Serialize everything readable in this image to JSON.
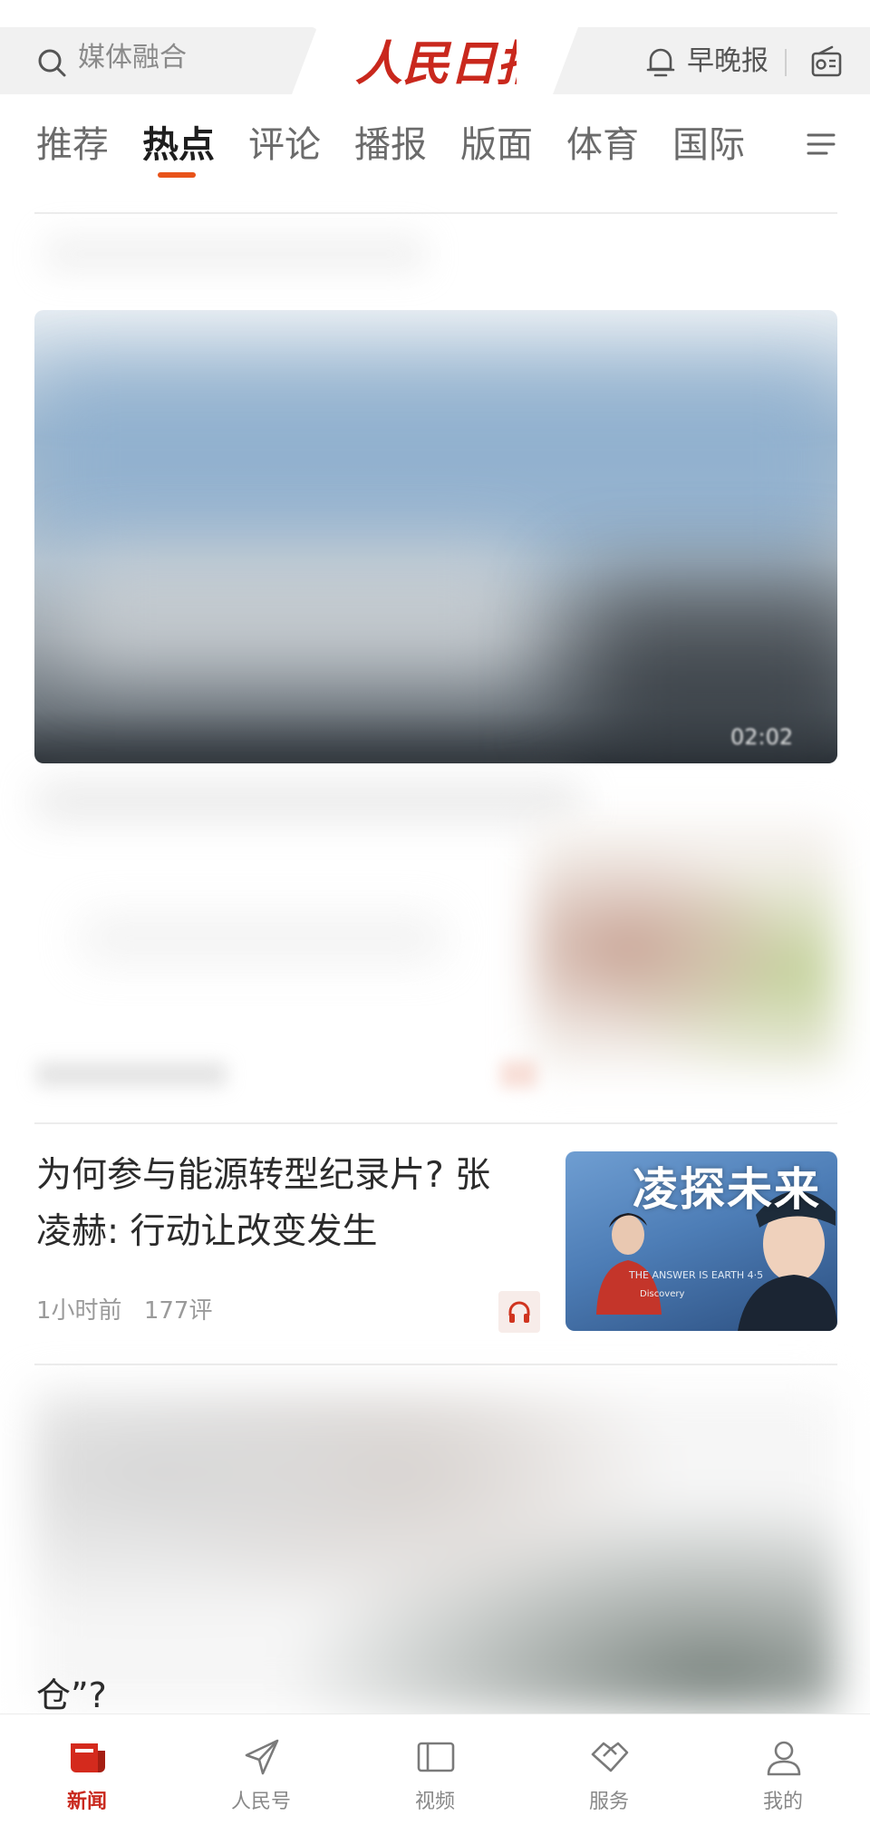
{
  "header": {
    "search_placeholder": "媒体融合",
    "logo_text": "人民日报",
    "morning_evening_label": "早晚报"
  },
  "tabs": {
    "items": [
      {
        "label": "推荐",
        "active": false
      },
      {
        "label": "热点",
        "active": true
      },
      {
        "label": "评论",
        "active": false
      },
      {
        "label": "播报",
        "active": false
      },
      {
        "label": "版面",
        "active": false
      },
      {
        "label": "体育",
        "active": false
      },
      {
        "label": "国际",
        "active": false
      }
    ],
    "accent_color": "#e8531a"
  },
  "feed": {
    "lead_video": {
      "duration": "02:02"
    },
    "news_item": {
      "title": "为何参与能源转型纪录片? 张凌赫: 行动让改变发生",
      "time": "1小时前",
      "comments": "177评",
      "thumbnail_title": "凌探未来",
      "thumbnail_subtitle": "THE ANSWER IS EARTH 4·5",
      "thumbnail_partner": "Discovery"
    },
    "partial_item_text": "仓”?"
  },
  "bottom_nav": {
    "items": [
      {
        "label": "新闻",
        "icon": "news-icon",
        "active": true
      },
      {
        "label": "人民号",
        "icon": "send-icon",
        "active": false
      },
      {
        "label": "视频",
        "icon": "video-icon",
        "active": false
      },
      {
        "label": "服务",
        "icon": "handshake-icon",
        "active": false
      },
      {
        "label": "我的",
        "icon": "profile-icon",
        "active": false
      }
    ],
    "active_color": "#c9281d"
  }
}
